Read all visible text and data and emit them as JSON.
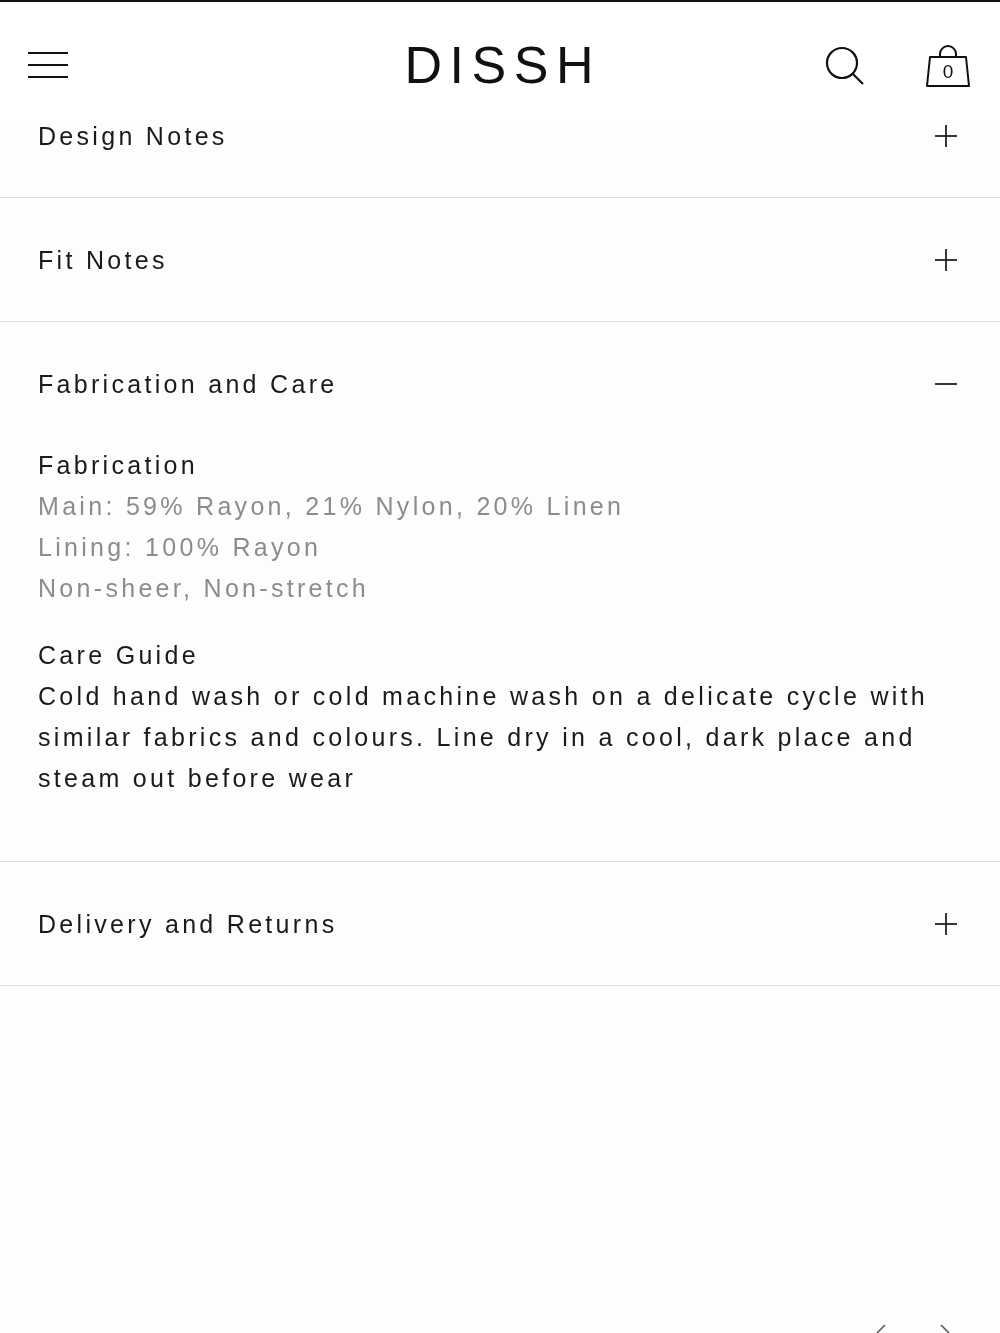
{
  "header": {
    "logo": "DISSH",
    "cart_count": "0"
  },
  "accordion": [
    {
      "title": "Design Notes",
      "expanded": false
    },
    {
      "title": "Fit Notes",
      "expanded": false
    },
    {
      "title": "Fabrication and Care",
      "expanded": true,
      "sections": [
        {
          "kind": "list",
          "heading": "Fabrication",
          "lines": [
            "Main: 59% Rayon, 21% Nylon, 20% Linen",
            "Lining: 100% Rayon",
            "Non-sheer, Non-stretch"
          ]
        },
        {
          "kind": "paragraph",
          "heading": "Care Guide",
          "text": "Cold hand wash or cold machine wash on a delicate cycle with similar fabrics and colours. Line dry in a cool, dark place and steam out before wear"
        }
      ]
    },
    {
      "title": "Delivery and Returns",
      "expanded": false
    }
  ]
}
